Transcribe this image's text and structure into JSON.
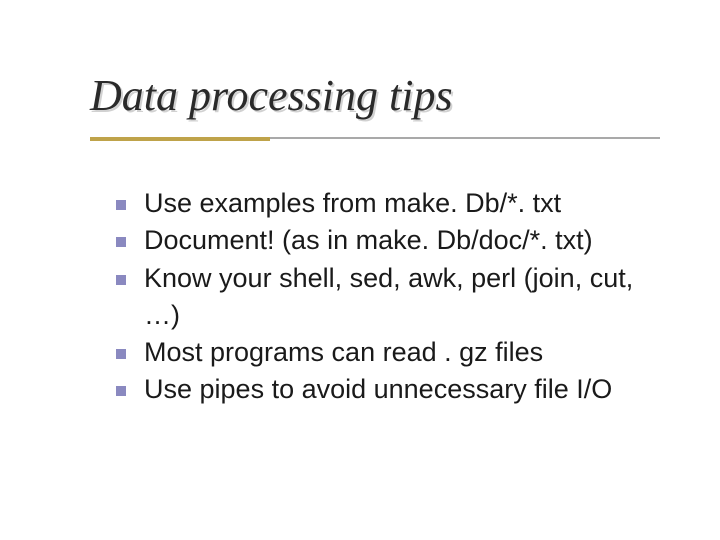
{
  "title": "Data processing tips",
  "bullets": {
    "b0": "Use examples from make. Db/*. txt",
    "b1": "Document!  (as in make. Db/doc/*. txt)",
    "b2": "Know your shell, sed, awk, perl (join, cut, …)",
    "b3": "Most programs can read . gz files",
    "b4": "Use pipes to avoid unnecessary file I/O"
  }
}
